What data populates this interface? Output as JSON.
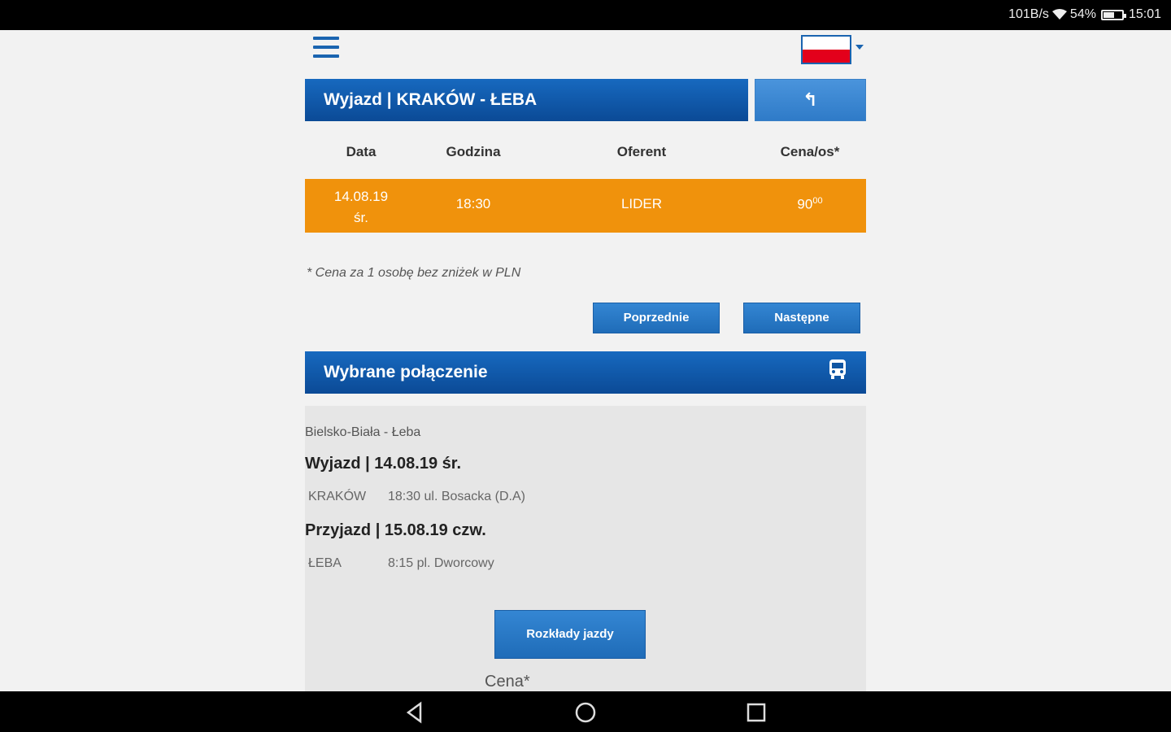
{
  "status": {
    "speed": "101B/s",
    "battery": "54%",
    "time": "15:01"
  },
  "header": {
    "route_title": "Wyjazd | KRAKÓW - ŁEBA",
    "back_label": "↰"
  },
  "table": {
    "columns": [
      "Data",
      "Godzina",
      "Oferent",
      "Cena/os*"
    ],
    "row": {
      "date": "14.08.19",
      "day": "śr.",
      "time": "18:30",
      "operator": "LIDER",
      "price_main": "90",
      "price_cents": "00"
    }
  },
  "note": "* Cena za 1 osobę bez zniżek w PLN",
  "nav": {
    "prev": "Poprzednie",
    "next": "Następne"
  },
  "selected": {
    "title": "Wybrane połączenie",
    "route": "Bielsko-Biała - Łeba",
    "departure_title": "Wyjazd | 14.08.19 śr.",
    "departure_city": "KRAKÓW",
    "departure_time": "18:30 ul. Bosacka (D.A)",
    "arrival_title": "Przyjazd | 15.08.19 czw.",
    "arrival_city": "ŁEBA",
    "arrival_time": "8:15 pl. Dworcowy",
    "schedule_button": "Rozkłady jazdy",
    "price_label": "Cena*"
  }
}
